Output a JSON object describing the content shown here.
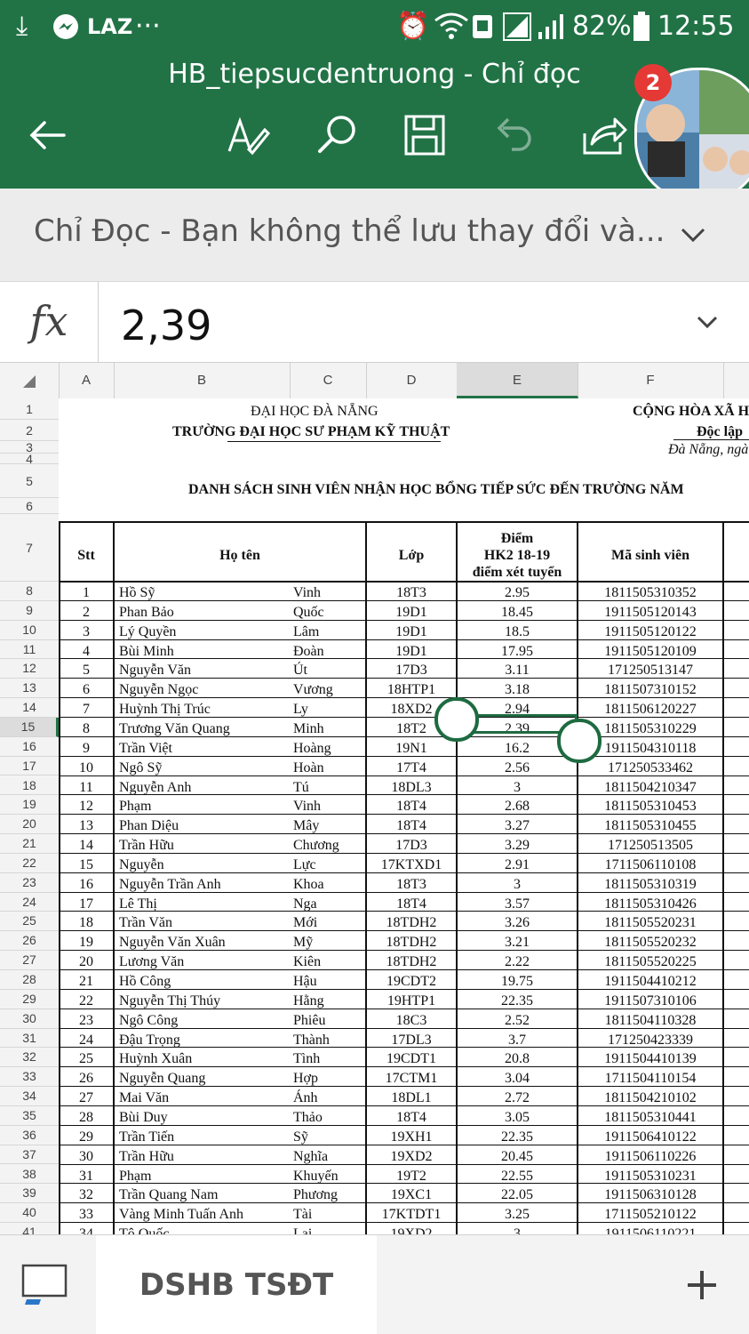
{
  "status_bar": {
    "left_items": [
      "LAZ",
      "···"
    ],
    "battery": "82%",
    "time": "12:55"
  },
  "app_bar": {
    "title": "HB_tiepsucdentruong - Chỉ đọc",
    "notification_count": "2"
  },
  "banner": {
    "text": "Chỉ Đọc - Bạn không thể lưu thay đổi và..."
  },
  "formula_bar": {
    "fx_label": "fx",
    "value": "2,39"
  },
  "columns": [
    "A",
    "B",
    "C",
    "D",
    "E",
    "F"
  ],
  "row_numbers": [
    "1",
    "2",
    "3",
    "4",
    "5",
    "6",
    "7",
    "8",
    "9",
    "10",
    "11",
    "12",
    "13",
    "14",
    "15",
    "16",
    "17",
    "18",
    "19",
    "20",
    "21",
    "22",
    "23",
    "24",
    "25",
    "26",
    "27",
    "28",
    "29",
    "30",
    "31",
    "32",
    "33",
    "34",
    "35",
    "36",
    "37",
    "38",
    "39",
    "40",
    "41"
  ],
  "sheet_text": {
    "uni_name": "ĐẠI HỌC ĐÀ NẴNG",
    "school_name": "TRƯỜNG ĐẠI HỌC SƯ PHẠM KỸ THUẬT",
    "republic": "CỘNG HÒA XÃ H",
    "independence": "Độc lập",
    "place_date": "Đà Nẵng, ngà",
    "list_title": "DANH SÁCH SINH VIÊN NHẬN HỌC BỔNG TIẾP SỨC ĐẾN TRƯỜNG NĂM"
  },
  "table_headers": {
    "stt": "Stt",
    "name": "Họ tên",
    "class": "Lớp",
    "score_line1": "Điểm",
    "score_line2": "HK2 18-19",
    "score_line3": "điểm xét tuyển",
    "student_id": "Mã sinh viên"
  },
  "rows": [
    {
      "stt": "1",
      "last": "Hồ Sỹ",
      "first": "Vinh",
      "cls": "18T3",
      "score": "2.95",
      "id": "1811505310352"
    },
    {
      "stt": "2",
      "last": "Phan Bảo",
      "first": "Quốc",
      "cls": "19D1",
      "score": "18.45",
      "id": "1911505120143"
    },
    {
      "stt": "3",
      "last": "Lý Quyền",
      "first": "Lâm",
      "cls": "19D1",
      "score": "18.5",
      "id": "1911505120122"
    },
    {
      "stt": "4",
      "last": "Bùi Minh",
      "first": "Đoàn",
      "cls": "19D1",
      "score": "17.95",
      "id": "1911505120109"
    },
    {
      "stt": "5",
      "last": "Nguyễn Văn",
      "first": "Út",
      "cls": "17D3",
      "score": "3.11",
      "id": "171250513147"
    },
    {
      "stt": "6",
      "last": "Nguyễn Ngọc",
      "first": "Vương",
      "cls": "18HTP1",
      "score": "3.18",
      "id": "1811507310152"
    },
    {
      "stt": "7",
      "last": "Huỳnh Thị Trúc",
      "first": "Ly",
      "cls": "18XD2",
      "score": "2.94",
      "id": "1811506120227"
    },
    {
      "stt": "8",
      "last": "Trương Văn Quang",
      "first": "Minh",
      "cls": "18T2",
      "score": "2.39",
      "id": "1811505310229"
    },
    {
      "stt": "9",
      "last": "Trần Việt",
      "first": "Hoàng",
      "cls": "19N1",
      "score": "16.2",
      "id": "1911504310118"
    },
    {
      "stt": "10",
      "last": "Ngô Sỹ",
      "first": "Hoàn",
      "cls": "17T4",
      "score": "2.56",
      "id": "171250533462"
    },
    {
      "stt": "11",
      "last": "Nguyễn Anh",
      "first": "Tú",
      "cls": "18DL3",
      "score": "3",
      "id": "1811504210347"
    },
    {
      "stt": "12",
      "last": "Phạm",
      "first": "Vinh",
      "cls": "18T4",
      "score": "2.68",
      "id": "1811505310453"
    },
    {
      "stt": "13",
      "last": "Phan Diệu",
      "first": "Mây",
      "cls": "18T4",
      "score": "3.27",
      "id": "1811505310455"
    },
    {
      "stt": "14",
      "last": "Trần Hữu",
      "first": "Chương",
      "cls": "17D3",
      "score": "3.29",
      "id": "171250513505"
    },
    {
      "stt": "15",
      "last": "Nguyễn",
      "first": "Lực",
      "cls": "17KTXD1",
      "score": "2.91",
      "id": "1711506110108"
    },
    {
      "stt": "16",
      "last": "Nguyễn Trần Anh",
      "first": "Khoa",
      "cls": "18T3",
      "score": "3",
      "id": "1811505310319"
    },
    {
      "stt": "17",
      "last": "Lê Thị",
      "first": "Nga",
      "cls": "18T4",
      "score": "3.57",
      "id": "1811505310426"
    },
    {
      "stt": "18",
      "last": "Trần Văn",
      "first": "Mới",
      "cls": "18TDH2",
      "score": "3.26",
      "id": "1811505520231"
    },
    {
      "stt": "19",
      "last": "Nguyễn Văn Xuân",
      "first": "Mỹ",
      "cls": "18TDH2",
      "score": "3.21",
      "id": "1811505520232"
    },
    {
      "stt": "20",
      "last": "Lương Văn",
      "first": "Kiên",
      "cls": "18TDH2",
      "score": "2.22",
      "id": "1811505520225"
    },
    {
      "stt": "21",
      "last": "Hồ Công",
      "first": "Hậu",
      "cls": "19CDT2",
      "score": "19.75",
      "id": "1911504410212"
    },
    {
      "stt": "22",
      "last": "Nguyễn Thị Thúy",
      "first": "Hằng",
      "cls": "19HTP1",
      "score": "22.35",
      "id": "1911507310106"
    },
    {
      "stt": "23",
      "last": "Ngô Công",
      "first": "Phiêu",
      "cls": "18C3",
      "score": "2.52",
      "id": "1811504110328"
    },
    {
      "stt": "24",
      "last": "Đậu Trọng",
      "first": "Thành",
      "cls": "17DL3",
      "score": "3.7",
      "id": "171250423339"
    },
    {
      "stt": "25",
      "last": "Huỳnh Xuân",
      "first": "Tình",
      "cls": "19CDT1",
      "score": "20.8",
      "id": "1911504410139"
    },
    {
      "stt": "26",
      "last": "Nguyễn Quang",
      "first": "Hợp",
      "cls": "17CTM1",
      "score": "3.04",
      "id": "1711504110154"
    },
    {
      "stt": "27",
      "last": "Mai Văn",
      "first": "Ánh",
      "cls": "18DL1",
      "score": "2.72",
      "id": "1811504210102"
    },
    {
      "stt": "28",
      "last": "Bùi Duy",
      "first": "Thảo",
      "cls": "18T4",
      "score": "3.05",
      "id": "1811505310441"
    },
    {
      "stt": "29",
      "last": "Trần Tiến",
      "first": "Sỹ",
      "cls": "19XH1",
      "score": "22.35",
      "id": "1911506410122"
    },
    {
      "stt": "30",
      "last": "Trần Hữu",
      "first": "Nghĩa",
      "cls": "19XD2",
      "score": "20.45",
      "id": "1911506110226"
    },
    {
      "stt": "31",
      "last": "Phạm",
      "first": "Khuyến",
      "cls": "19T2",
      "score": "22.55",
      "id": "1911505310231"
    },
    {
      "stt": "32",
      "last": "Trần Quang Nam",
      "first": "Phương",
      "cls": "19XC1",
      "score": "22.05",
      "id": "1911506310128"
    },
    {
      "stt": "33",
      "last": "Vàng Minh Tuấn Anh",
      "first": "Tài",
      "cls": "17KTDT1",
      "score": "3.25",
      "id": "1711505210122"
    },
    {
      "stt": "34",
      "last": "Tô Quốc",
      "first": "Lai",
      "cls": "19XD2",
      "score": "3",
      "id": "1911506110221"
    }
  ],
  "selected_row_index": 7,
  "sheet_tab": {
    "label": "DSHB TSĐT"
  },
  "colors": {
    "excel_green": "#217346",
    "selection_green": "#1e6b41"
  }
}
